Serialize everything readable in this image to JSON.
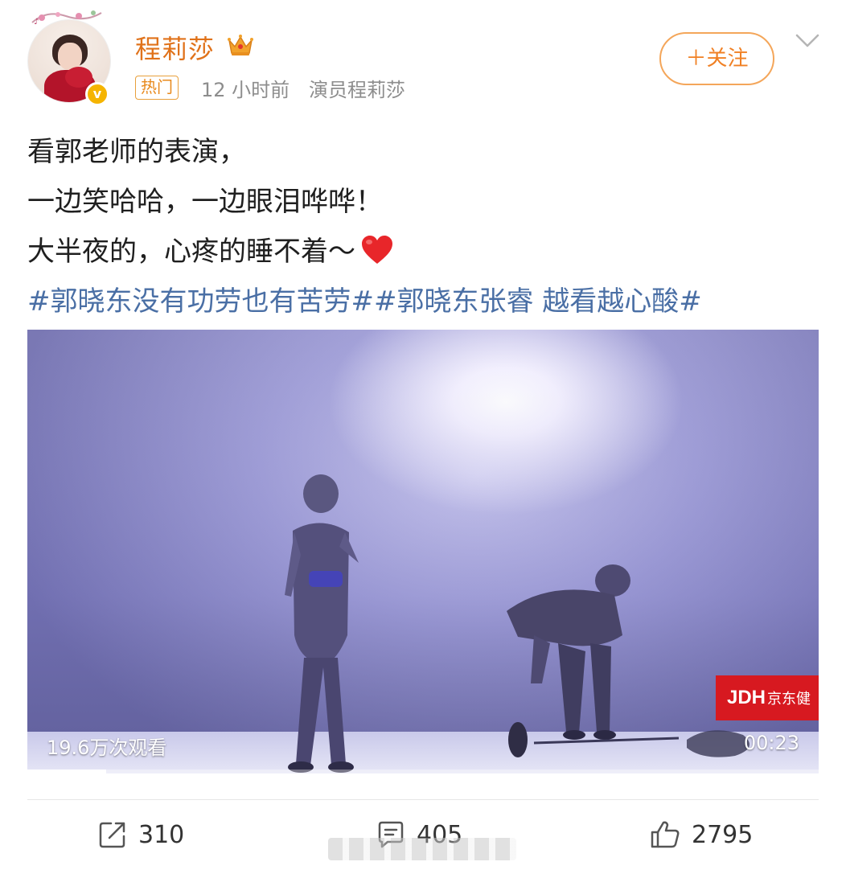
{
  "post": {
    "author": {
      "name": "程莉莎",
      "badge_icon": "crown-icon",
      "verified_icon": "verified-badge-icon",
      "verified_mark": "v"
    },
    "hot_tag": "热门",
    "time": "12 小时前",
    "source": "演员程莉莎",
    "follow_label": "＋关注",
    "lines": [
      "看郭老师的表演，",
      "一边笑哈哈，一边眼泪哗哗！",
      "大半夜的，心疼的睡不着～"
    ],
    "hashtags": "#郭晓东没有功劳也有苦劳##郭晓东张睿 越看越心酸#",
    "video": {
      "view_count": "19.6万次观看",
      "duration": "00:23",
      "watermark_logo": "JDH",
      "watermark_text": "京东健",
      "progress": 0.1
    },
    "actions": {
      "repost_count": "310",
      "comment_count": "405",
      "like_count": "2795"
    }
  },
  "colors": {
    "username": "#e0721a",
    "hashtag": "#4a6fa5",
    "follow": "#f08024",
    "meta": "#8d8d8d"
  }
}
